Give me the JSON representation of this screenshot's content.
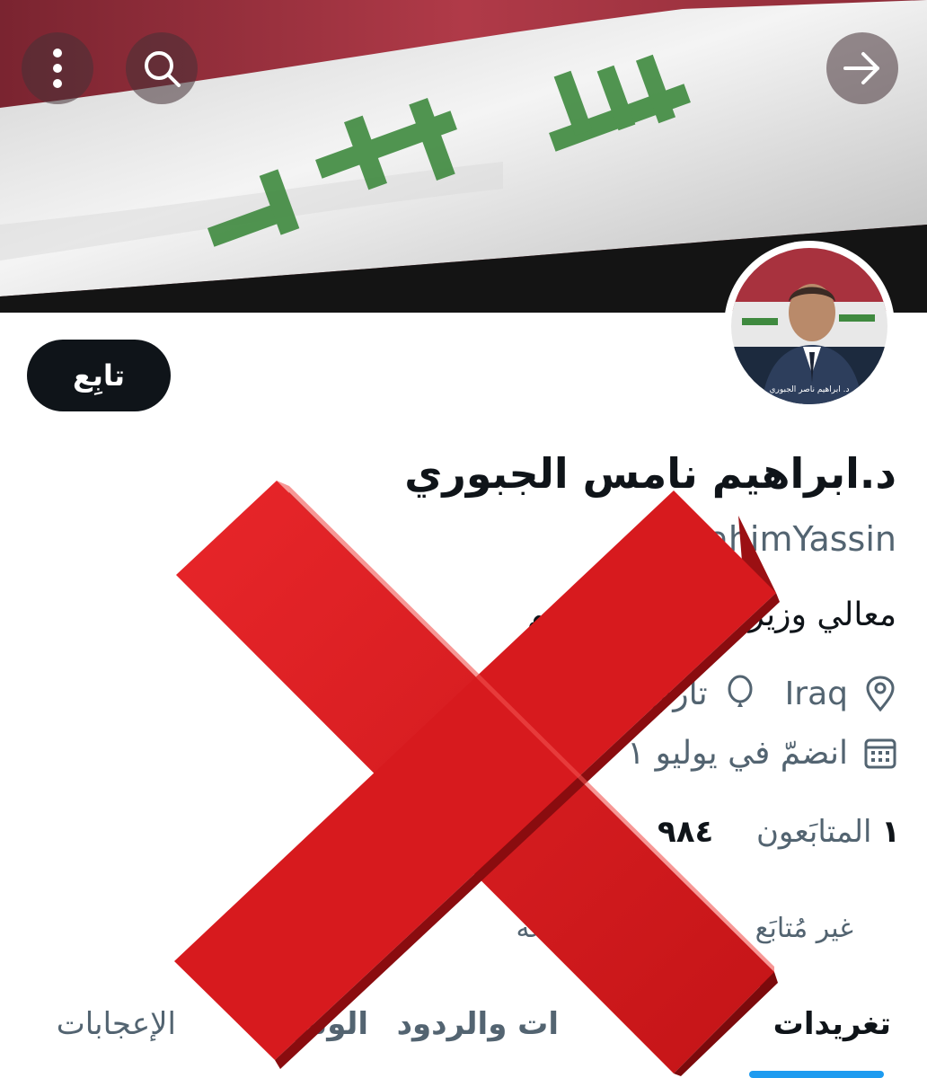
{
  "header": {
    "back_icon": "arrow-right-icon",
    "search_icon": "search-icon",
    "more_icon": "more-vertical-icon"
  },
  "banner": {
    "flag_text": "الله اكبر",
    "colors": {
      "red": "#a8323e",
      "white": "#f2f2f2",
      "black": "#161616",
      "green": "#3f8a3f"
    }
  },
  "avatar": {
    "caption": "د. ابراهيم ناصر الجبوري"
  },
  "follow_button": {
    "label": "تابِع"
  },
  "profile": {
    "name": "د.ابراهيم نامس الجبوري",
    "handle": "@IbrahimYassin",
    "bio_start": "معالي وزير",
    "bio_end": "ابراهيم"
  },
  "meta": {
    "location": "Iraq",
    "birth_fragment": "تاري",
    "join_prefix": "انضمّ في يوليو",
    "join_fragment": "١"
  },
  "stats": {
    "followers_count": "١",
    "followers_label": "المتابَعون",
    "second_count": "٩٨٤"
  },
  "not_followed": {
    "start": "غير مُتابَع",
    "end": "ن تتابعه"
  },
  "tabs": [
    {
      "label": "تغريدات"
    },
    {
      "label": "ات والردود"
    },
    {
      "label": "الوس"
    },
    {
      "label": "الإعجابات"
    }
  ],
  "overlay": {
    "symbol": "red-x-mark",
    "color": "#d7191c"
  }
}
